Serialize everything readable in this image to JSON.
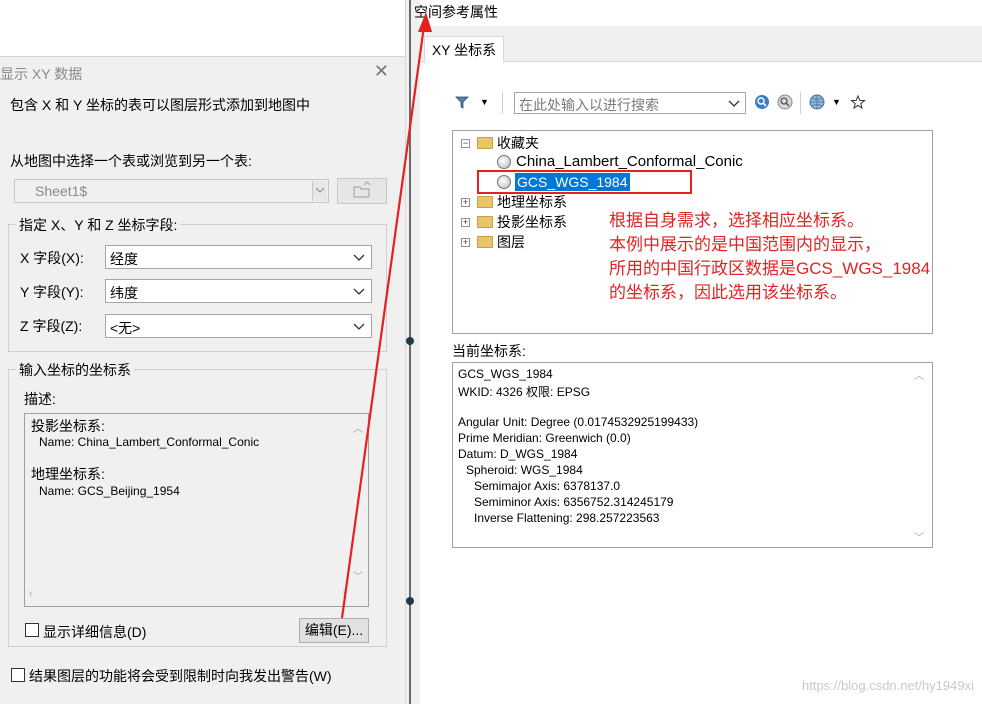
{
  "left_dialog": {
    "title": "显示 XY 数据",
    "close_icon": "close-icon",
    "intro": "包含 X 和 Y 坐标的表可以图层形式添加到地图中",
    "choose_table_label": "从地图中选择一个表或浏览到另一个表:",
    "table_value": "Sheet1$",
    "fields_group_title": "指定 X、Y 和 Z 坐标字段:",
    "x_label": "X 字段(X):",
    "x_value": "经度",
    "y_label": "Y 字段(Y):",
    "y_value": "纬度",
    "z_label": "Z 字段(Z):",
    "z_value": "<无>",
    "coord_group_title": "输入坐标的坐标系",
    "desc_label": "描述:",
    "desc_lines": [
      "投影坐标系:",
      "Name: China_Lambert_Conformal_Conic",
      "地理坐标系:",
      "Name: GCS_Beijing_1954"
    ],
    "show_details_label": "显示详细信息(D)",
    "edit_button": "编辑(E)...",
    "warn_label": "结果图层的功能将会受到限制时向我发出警告(W)"
  },
  "right_dialog": {
    "title": "空间参考属性",
    "tab_label": "XY 坐标系",
    "search_placeholder": "在此处输入以进行搜索",
    "tree": {
      "favorites": "收藏夹",
      "fav_item_1": "China_Lambert_Conformal_Conic",
      "fav_item_2": "GCS_WGS_1984",
      "geo_cs": "地理坐标系",
      "proj_cs": "投影坐标系",
      "layers": "图层"
    },
    "annotation_lines": [
      "根据自身需求，选择相应坐标系。",
      "本例中展示的是中国范围内的显示，",
      "所用的中国行政区数据是GCS_WGS_1984",
      "的坐标系，因此选用该坐标系。"
    ],
    "current_label": "当前坐标系:",
    "current_lines": [
      "GCS_WGS_1984",
      "WKID: 4326 权限: EPSG",
      "",
      "Angular Unit: Degree (0.0174532925199433)",
      "Prime Meridian: Greenwich (0.0)",
      "Datum: D_WGS_1984",
      "  Spheroid: WGS_1984",
      "    Semimajor Axis: 6378137.0",
      "    Semiminor Axis: 6356752.314245179",
      "    Inverse Flattening: 298.257223563"
    ]
  },
  "watermark": "https://blog.csdn.net/hy1949xi",
  "colors": {
    "annotation_red": "#e02424",
    "selection_blue": "#0078d7",
    "dialog_bg": "#f0f0f0"
  }
}
